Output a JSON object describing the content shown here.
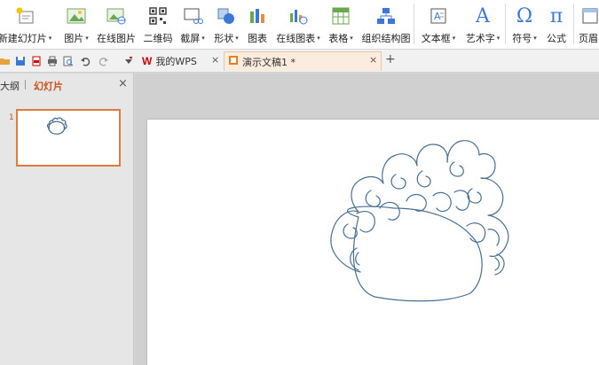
{
  "ribbon": {
    "buttons": [
      {
        "label": "新建幻灯片",
        "icon": "new-slide-icon",
        "dropdown": true
      },
      {
        "label": "图片",
        "icon": "picture-icon",
        "dropdown": true
      },
      {
        "label": "在线图片",
        "icon": "online-picture-icon",
        "dropdown": false
      },
      {
        "label": "二维码",
        "icon": "qrcode-icon",
        "dropdown": false
      },
      {
        "label": "截屏",
        "icon": "screenshot-icon",
        "dropdown": true
      },
      {
        "label": "形状",
        "icon": "shapes-icon",
        "dropdown": true
      },
      {
        "label": "图表",
        "icon": "chart-icon",
        "dropdown": false
      },
      {
        "label": "在线图表",
        "icon": "online-chart-icon",
        "dropdown": true
      },
      {
        "label": "表格",
        "icon": "table-icon",
        "dropdown": true
      },
      {
        "label": "组织结构图",
        "icon": "org-chart-icon",
        "dropdown": false
      },
      {
        "label": "文本框",
        "icon": "textbox-icon",
        "dropdown": true
      },
      {
        "label": "艺术字",
        "icon": "wordart-icon",
        "dropdown": true
      },
      {
        "label": "符号",
        "icon": "symbol-icon",
        "dropdown": true
      },
      {
        "label": "公式",
        "icon": "formula-icon",
        "dropdown": false
      },
      {
        "label": "页眉",
        "icon": "header-icon",
        "dropdown": false
      }
    ],
    "glyphs": {
      "wordart": "A",
      "symbol": "Ω",
      "formula": "π"
    }
  },
  "tabs": {
    "my_wps": "我的WPS",
    "document": "演示文稿1 *",
    "close_glyph": "×",
    "add_glyph": "+"
  },
  "panel": {
    "outline_tab": "大纲",
    "slides_tab": "幻灯片",
    "close_glyph": "×",
    "slide_number": "1"
  },
  "colors": {
    "accent": "#c7521a",
    "thumb_border": "#e07b3c",
    "drawing_stroke": "#4a6f91"
  }
}
